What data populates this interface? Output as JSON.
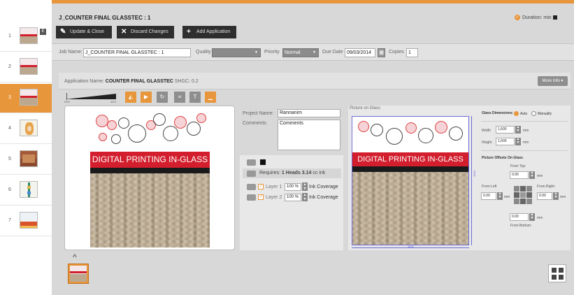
{
  "thumbnails": [
    {
      "num": "1",
      "badge": "E"
    },
    {
      "num": "2"
    },
    {
      "num": "3",
      "selected": true
    },
    {
      "num": "4"
    },
    {
      "num": "5"
    },
    {
      "num": "6"
    },
    {
      "num": "7"
    }
  ],
  "header": {
    "title": "J_COUNTER FINAL GLASSTEC : 1",
    "update_label": "Update & Close",
    "discard_label": "Discard Changes",
    "add_label": "Add Application",
    "duration_label": "Duration:",
    "duration_unit": "min"
  },
  "job": {
    "job_name_label": "Job Name:",
    "job_name_value": "J_COUNTER FINAL GLASSTEC : 1",
    "quality_label": "Quality",
    "quality_value": "",
    "priority_label": "Priority",
    "priority_value": "Normal",
    "due_label": "Due Date",
    "due_value": "09/03/2014",
    "copies_label": "Copies",
    "copies_value": "1"
  },
  "application": {
    "name_label": "Application Name:",
    "name_value": "COUNTER FINAL GLASSTEC",
    "shgc_label": "SHGC:",
    "shgc_value": "0.2",
    "more_info_label": "More Info",
    "slider_min": "90%",
    "slider_max": "40%"
  },
  "artwork": {
    "banner_text": "DIGITAL PRINTING IN-GLASS"
  },
  "project": {
    "name_label": "Project Name:",
    "name_value": "Rannanim",
    "comments_label": "Comments",
    "comments_value": "Comments"
  },
  "ink": {
    "requires_label": "Requires:",
    "heads_value": "1 Heads",
    "ink_value": "3.14",
    "ink_unit": "cc ink",
    "layers": [
      {
        "label": "Layer 1",
        "value": "100 %",
        "coverage_label": "Ink Coverage"
      },
      {
        "label": "Layer 2",
        "value": "100 %",
        "coverage_label": "Ink Coverage"
      }
    ]
  },
  "picture_on_glass": {
    "title": "Picture on Glass",
    "width_dim": "1600",
    "height_dim": "1600"
  },
  "glass_dimensions": {
    "title": "Glass Dimensions:",
    "auto_label": "Auto",
    "manual_label": "Manually",
    "width_label": "Width",
    "width_value": "1,600",
    "height_label": "Height",
    "height_value": "1,600",
    "unit": "mm",
    "offsets_title": "Picture Offsets On Glass",
    "from_top_label": "From Top:",
    "from_top_value": "0.00",
    "from_left_label": "From Left",
    "from_left_value": "0.00",
    "from_right_label": "From Right:",
    "from_right_value": "0.00",
    "from_bottom_value": "0.00",
    "from_bottom_label": "From Bottom:"
  },
  "colors": {
    "accent": "#e8963b",
    "banner_red": "#d21e2d",
    "dark_button": "#2e2e2e"
  }
}
